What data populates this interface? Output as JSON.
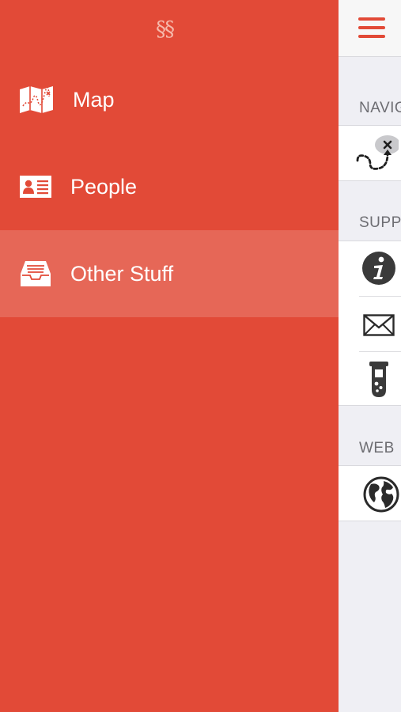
{
  "drawer": {
    "logo": "§§",
    "items": [
      {
        "label": "Map",
        "icon": "map-icon",
        "selected": false
      },
      {
        "label": "People",
        "icon": "id-card-icon",
        "selected": false
      },
      {
        "label": "Other Stuff",
        "icon": "inbox-tray-icon",
        "selected": true
      }
    ]
  },
  "main": {
    "menu_icon": "hamburger-menu-icon",
    "sections": [
      {
        "header": "NAVIGATION",
        "cells": [
          {
            "icon": "trail-path-icon"
          }
        ]
      },
      {
        "header": "SUPPORT",
        "cells": [
          {
            "icon": "info-icon"
          },
          {
            "icon": "mail-icon"
          },
          {
            "icon": "test-tube-icon"
          }
        ]
      },
      {
        "header": "WEB",
        "cells": [
          {
            "icon": "globe-icon"
          }
        ]
      }
    ]
  },
  "colors": {
    "accent": "#e24a37",
    "drawer_background": "#e24a37",
    "selected_row": "#e76b5b",
    "main_background": "#efeff4",
    "icon_dark": "#3a3a3a"
  }
}
